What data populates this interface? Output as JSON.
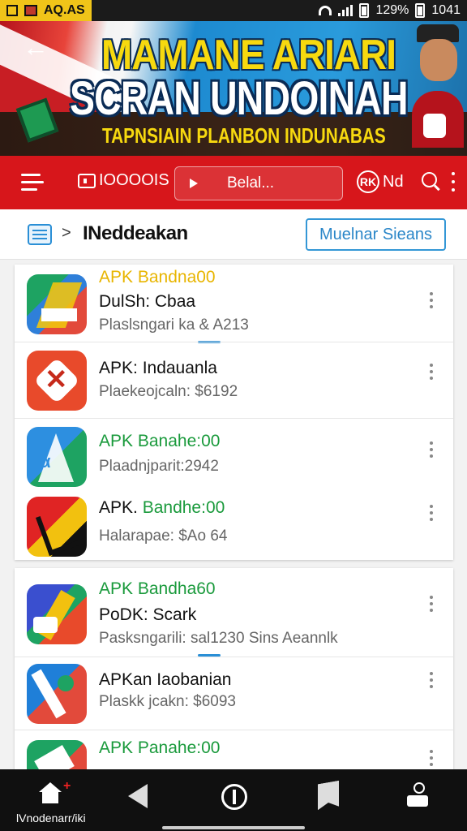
{
  "status_bar": {
    "carrier_text": "AQ.AS",
    "battery_text": "129%",
    "time": "1041"
  },
  "banner": {
    "title_line1": "MAMANE ARIARI",
    "title_line2": "SCRAN UNDOINAH",
    "subtitle": "TAPNSIAIN PLANBON INDUNABAS"
  },
  "app_bar": {
    "category_label": "IOOOOIS",
    "search_label": "Belal...",
    "user_label": "Nd",
    "user_badge": "RK"
  },
  "breadcrumb": {
    "label": "INeddeakan",
    "chevron": ">",
    "button_label": "Muelnar Sieans"
  },
  "apps": [
    {
      "line1": "APK Bandna00",
      "line1_color": "yellow",
      "line2": "DulSh: Cbaa",
      "line3": "Plaslsngari ka & A213",
      "line3_color": "gray"
    },
    {
      "line1": "APK: Indauanla",
      "line1_color": "black",
      "line2": "",
      "line3": "Plaekeojcaln: $6192",
      "line3_color": "yellow"
    },
    {
      "line1": "APK Banahe:00",
      "line1_color": "green",
      "line2": "",
      "line3": "Plaadnjparit:2942",
      "line3_color": "gray"
    },
    {
      "line1": "APK.",
      "line1b": "Bandhe:00",
      "line1_color": "black",
      "line2": "",
      "line3": "Halarapae: $Ao 64",
      "line3_color": "green"
    },
    {
      "line1": "APK Bandha60",
      "line1_color": "green",
      "line2": "PoDK: Scark",
      "line3": "Pasksngarili: sal1230 Sins Aeannlk",
      "line3_color": "gray"
    },
    {
      "line1": "APKan Iaobanian",
      "line1_color": "black",
      "line2": "",
      "line3": "Plaskk jcakn: $6093",
      "line3_color": "yellow"
    },
    {
      "line1": "APK Panahe:00",
      "line1_color": "green",
      "line2": "",
      "line3": "",
      "line3_color": "gray"
    }
  ],
  "bottom_nav": {
    "home_label": "lVnodenarr/iki",
    "home_badge": "+"
  },
  "colors": {
    "app_bar": "#d7161b",
    "accent_blue": "#2a8fd6",
    "yellow": "#e8b500",
    "green": "#1a9a3c"
  }
}
